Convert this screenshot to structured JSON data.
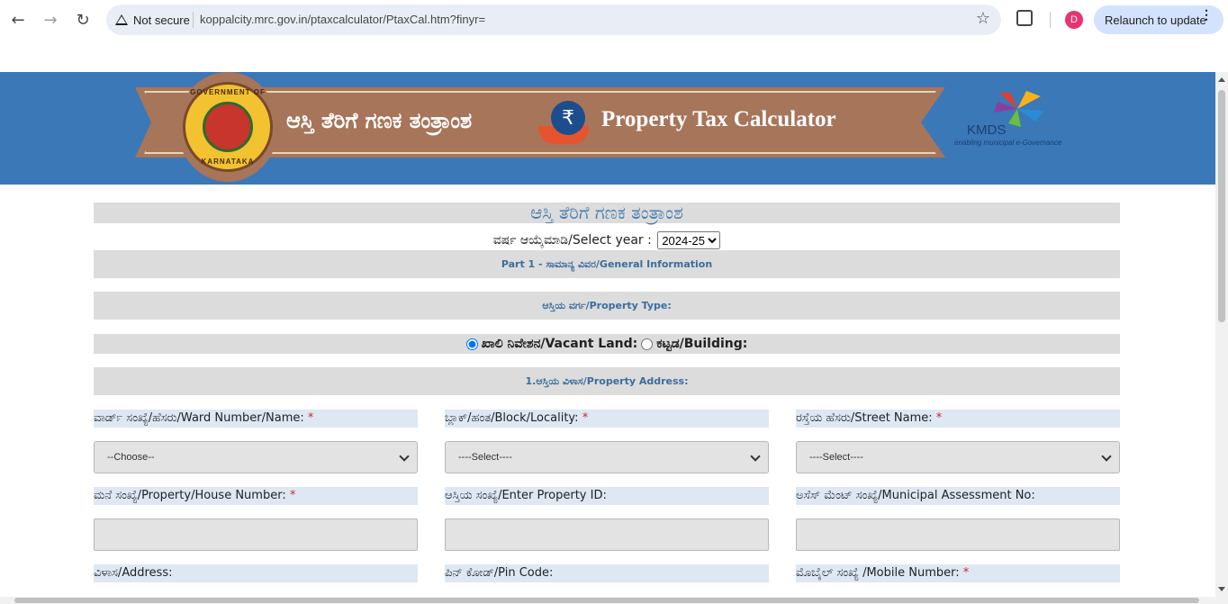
{
  "browser": {
    "security_label": "Not secure",
    "url": "koppalcity.mrc.gov.in/ptaxcalculator/PtaxCal.htm?finyr=",
    "profile_initial": "D",
    "relaunch_label": "Relaunch to update"
  },
  "banner": {
    "emblem_top": "GOVERNMENT OF",
    "emblem_bottom": "KARNATAKA",
    "title_kn": "ಆಸ್ತಿ ತೆರಿಗೆ ಗಣಕ ತಂತ್ರಾಂಶ",
    "title_en": "Property Tax Calculator",
    "kmds_name": "KMDS",
    "kmds_tagline": "enabling municipal e-Governance"
  },
  "form": {
    "heading": "ಆಸ್ತಿ ತೆರಿಗೆ ಗಣಕ ತಂತ್ರಾಂಶ",
    "year_label": "ವರ್ಷ ಆಯ್ಕೆಮಾಡಿ/Select year :",
    "year_value": "2024-25",
    "part1": "Part 1 - ಸಾಮಾನ್ಯ ವಿವರ/General Information",
    "property_type": "ಆಸ್ತಿಯ ವರ್ಗ/Property Type:",
    "vacant_land": "ಖಾಲಿ ನಿವೇಶನ/Vacant Land:",
    "building": "ಕಟ್ಟಡ/Building:",
    "address_section": "1.ಆಸ್ತಿಯ ವಿಳಾಸ/Property Address:",
    "ward_label": "ವಾರ್ಡ್ ಸಂಖ್ಯೆ/ಹೆಸರು/Ward Number/Name:",
    "block_label": "ಬ್ಲಾಕ್/ಹಂತ/Block/Locality:",
    "street_label": "ರಸ್ತೆಯ ಹೆಸರು/Street Name:",
    "ward_value": "--Choose--",
    "block_value": "----Select----",
    "street_value": "----Select----",
    "house_label": "ಮನೆ ಸಂಖ್ಯೆ/Property/House Number:",
    "propid_label": "ಆಸ್ತಿಯ ಸಂಖ್ಯೆ/Enter Property ID:",
    "assess_label": "ಅಸೆಸ್ ಮೆಂಟ್ ಸಂಖ್ಯೆ/Municipal Assessment No:",
    "address_label": "ವಿಳಾಸ/Address:",
    "pin_label": "ಪಿನ್ ಕೋಡ್/Pin Code:",
    "mobile_label": "ಮೊಬೈಲ್ ಸಂಖ್ಯೆ /Mobile Number:",
    "required_mark": "*"
  }
}
